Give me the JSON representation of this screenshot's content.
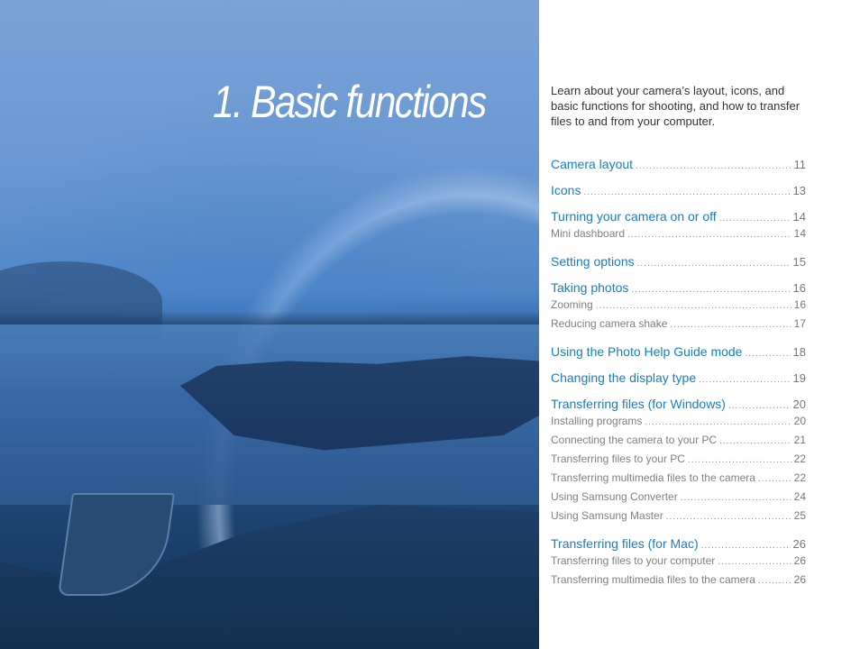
{
  "chapter_title": "1. Basic functions",
  "intro": "Learn about your camera’s layout, icons, and basic functions for shooting, and how to transfer files to and from your computer.",
  "colors": {
    "accent": "#1a7cc4",
    "subentry": "#808080"
  },
  "toc": [
    {
      "label": "Camera layout",
      "page": "11",
      "subs": []
    },
    {
      "label": "Icons",
      "page": "13",
      "subs": []
    },
    {
      "label": "Turning your camera on or off",
      "page": "14",
      "subs": [
        {
          "label": "Mini dashboard",
          "page": "14"
        }
      ]
    },
    {
      "label": "Setting options",
      "page": "15",
      "subs": []
    },
    {
      "label": "Taking photos",
      "page": "16",
      "subs": [
        {
          "label": "Zooming",
          "page": "16"
        },
        {
          "label": "Reducing camera shake",
          "page": "17"
        }
      ]
    },
    {
      "label": "Using the Photo Help Guide mode",
      "page": "18",
      "subs": []
    },
    {
      "label": "Changing the display type",
      "page": "19",
      "subs": []
    },
    {
      "label": "Transferring files (for Windows)",
      "page": "20",
      "subs": [
        {
          "label": "Installing programs",
          "page": "20"
        },
        {
          "label": "Connecting the camera to your PC",
          "page": "21"
        },
        {
          "label": "Transferring files to your PC",
          "page": "22"
        },
        {
          "label": "Transferring multimedia files to the camera",
          "page": "22"
        },
        {
          "label": "Using Samsung Converter",
          "page": "24"
        },
        {
          "label": "Using Samsung Master",
          "page": "25"
        }
      ]
    },
    {
      "label": "Transferring files (for Mac)",
      "page": "26",
      "subs": [
        {
          "label": "Transferring files to your computer",
          "page": "26"
        },
        {
          "label": "Transferring multimedia files to the camera",
          "page": "26"
        }
      ]
    }
  ]
}
